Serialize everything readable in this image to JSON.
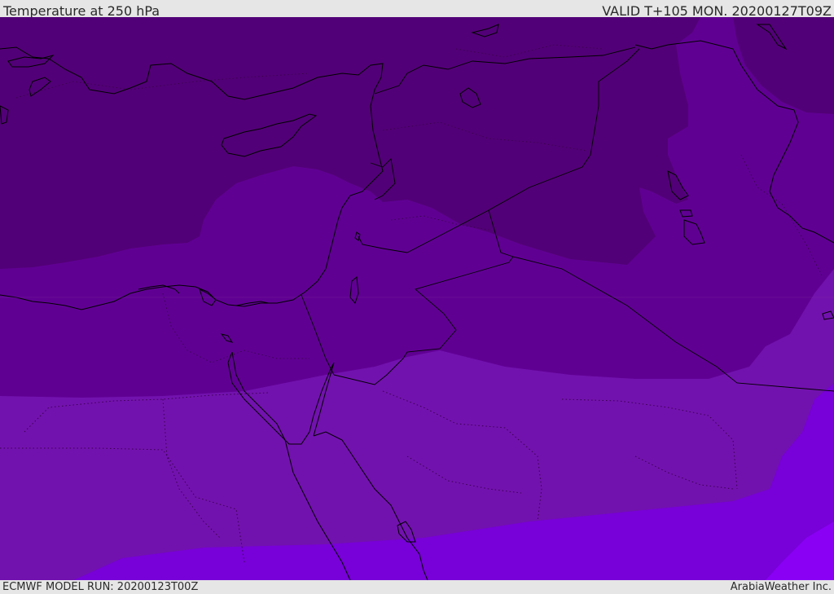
{
  "header": {
    "title": "Temperature at 250 hPa",
    "valid": "VALID T+105 MON. 20200127T09Z"
  },
  "footer": {
    "model_run": "ECMWF MODEL RUN: 20200123T00Z",
    "credit": "ArabiaWeather Inc."
  },
  "map": {
    "field": "temperature",
    "level": "250 hPa",
    "fill_colors": {
      "coldest": "#520077",
      "cold": "#600093",
      "mid": "#7212ae",
      "warm": "#7800d8",
      "warmest": "#8a00f5"
    },
    "line_colors": {
      "coastline": "#000000",
      "border": "#000000",
      "internal_boundary": "#3a004f"
    }
  }
}
